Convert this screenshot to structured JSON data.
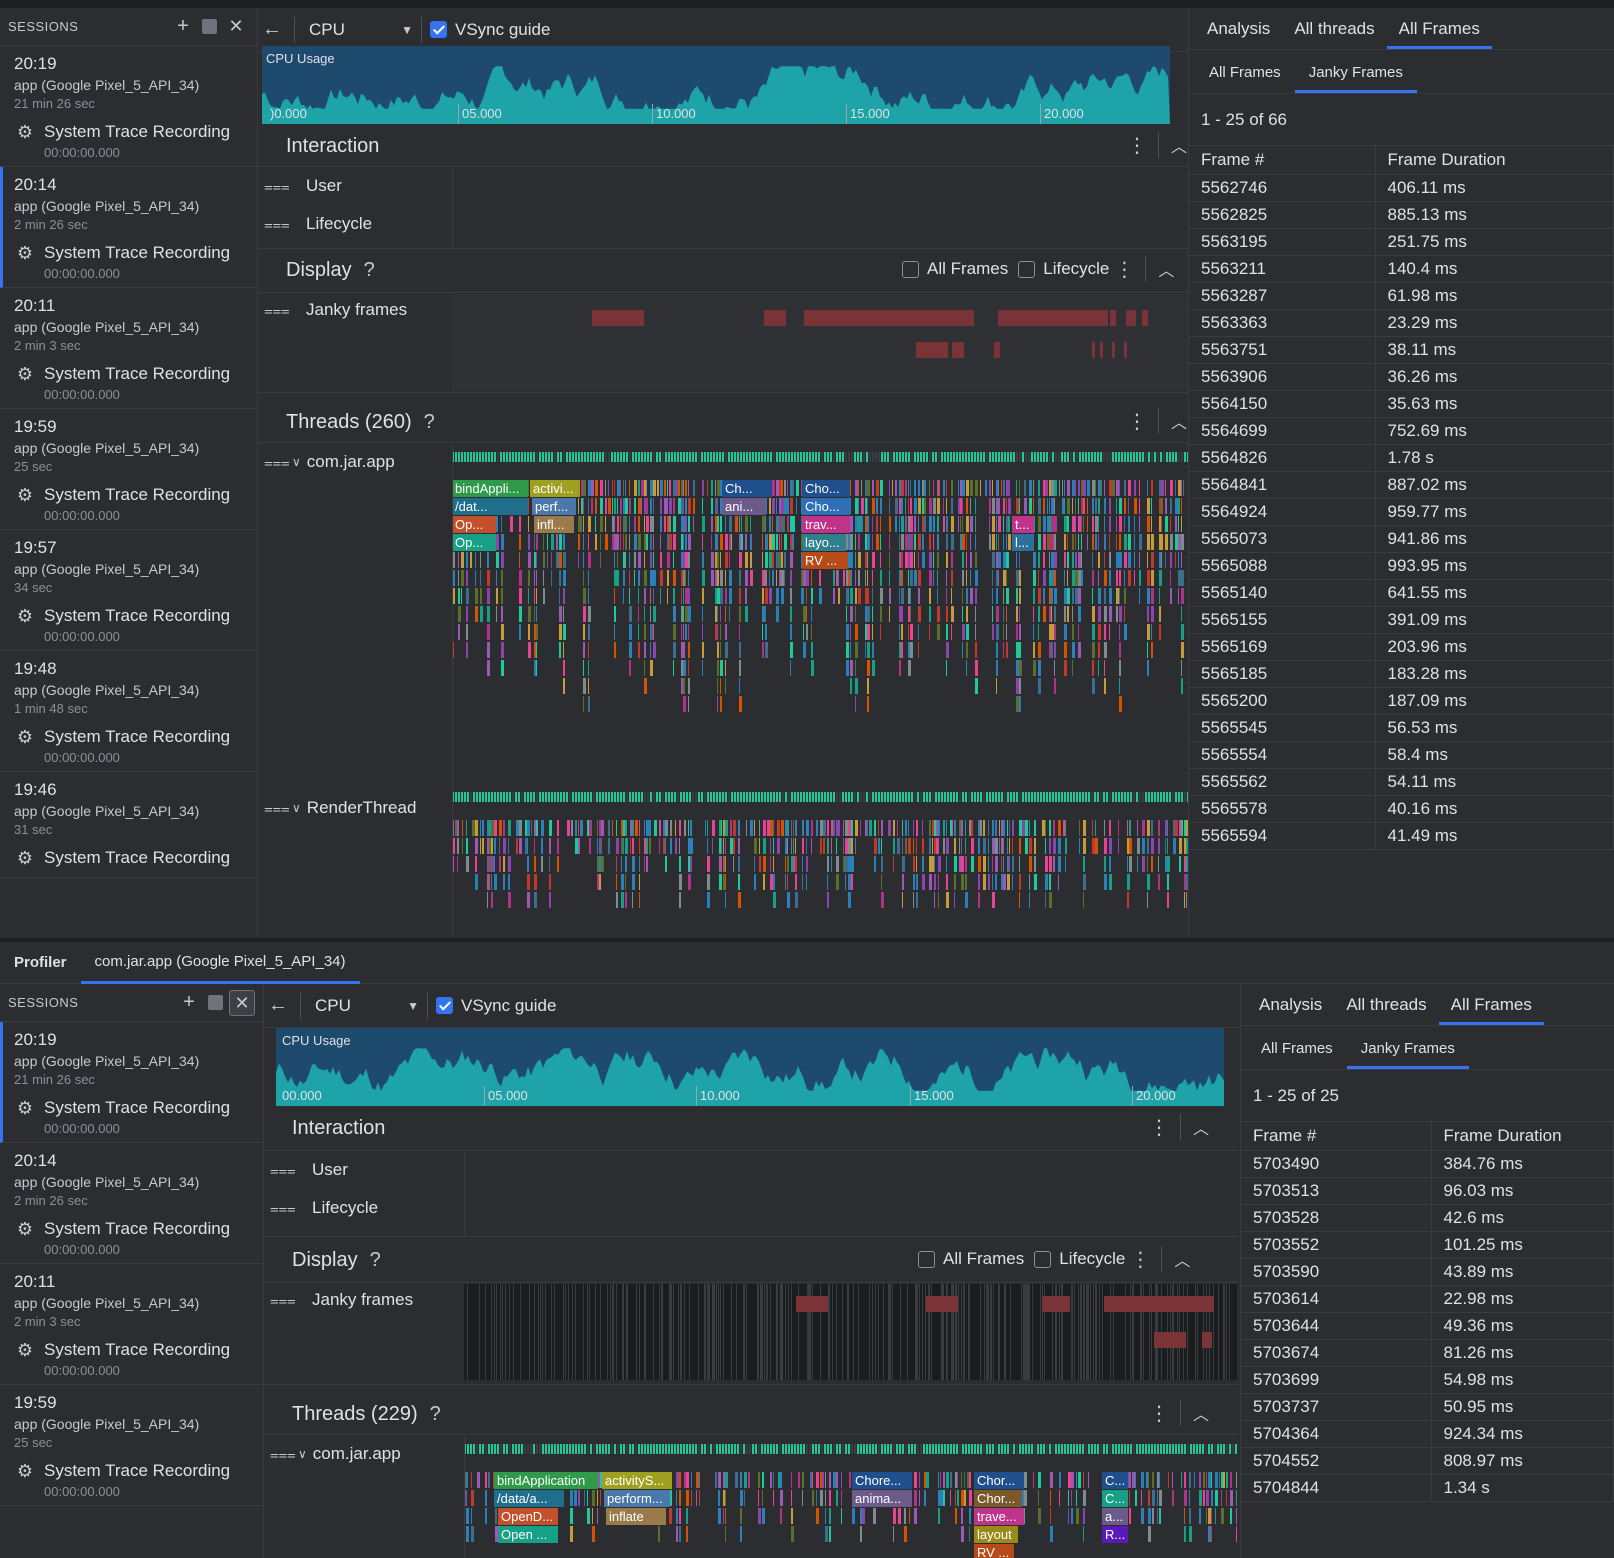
{
  "top": {
    "sessions_label": "SESSIONS",
    "sessions": [
      {
        "time": "20:19",
        "app": "app (Google Pixel_5_API_34)",
        "duration": "21 min 26 sec",
        "recording": "System Trace Recording",
        "rec_duration": "00:00:00.000"
      },
      {
        "time": "20:14",
        "app": "app (Google Pixel_5_API_34)",
        "duration": "2 min 26 sec",
        "recording": "System Trace Recording",
        "rec_duration": "00:00:00.000"
      },
      {
        "time": "20:11",
        "app": "app (Google Pixel_5_API_34)",
        "duration": "2 min 3 sec",
        "recording": "System Trace Recording",
        "rec_duration": "00:00:00.000"
      },
      {
        "time": "19:59",
        "app": "app (Google Pixel_5_API_34)",
        "duration": "25 sec",
        "recording": "System Trace Recording",
        "rec_duration": "00:00:00.000"
      },
      {
        "time": "19:57",
        "app": "app (Google Pixel_5_API_34)",
        "duration": "34 sec",
        "recording": "System Trace Recording",
        "rec_duration": "00:00:00.000"
      },
      {
        "time": "19:48",
        "app": "app (Google Pixel_5_API_34)",
        "duration": "1 min 48 sec",
        "recording": "System Trace Recording",
        "rec_duration": "00:00:00.000"
      },
      {
        "time": "19:46",
        "app": "app (Google Pixel_5_API_34)",
        "duration": "31 sec",
        "recording": "System Trace Recording",
        "rec_duration": ""
      }
    ],
    "toolbar": {
      "profiler_select": "CPU",
      "vsync_label": "VSync guide",
      "vsync_checked": true
    },
    "cpu": {
      "title": "CPU Usage",
      "ticks": [
        "00.000",
        "05.000",
        "10.000",
        "15.000",
        "20.000"
      ],
      "title_clip": "CPU Usage",
      "first_tick_clip": ")0.000"
    },
    "interaction": {
      "title": "Interaction",
      "tracks": [
        "User",
        "Lifecycle"
      ]
    },
    "display": {
      "title": "Display",
      "help": "?",
      "all_frames_label": "All Frames",
      "lifecycle_label": "Lifecycle",
      "track": "Janky frames"
    },
    "threads": {
      "title": "Threads (260)",
      "help": "?",
      "app_thread": "com.jar.app",
      "render_thread": "RenderThread",
      "slices": [
        "bindAppli...",
        "activi...",
        "/dat...",
        "perf...",
        "Op...",
        "infl...",
        "Op...",
        "Ch...",
        "ani...",
        "Cho...",
        "Cho...",
        "trav...",
        "layo...",
        "RV ...",
        "t...",
        "l..."
      ]
    },
    "right": {
      "tabs": [
        "Analysis",
        "All threads",
        "All Frames"
      ],
      "selected_tab": "All Frames",
      "subtabs": [
        "All Frames",
        "Janky Frames"
      ],
      "selected_subtab": "Janky Frames",
      "pager": "1 - 25 of 66",
      "col_frame": "Frame #",
      "col_duration": "Frame Duration",
      "rows": [
        [
          "5562746",
          "406.11 ms"
        ],
        [
          "5562825",
          "885.13 ms"
        ],
        [
          "5563195",
          "251.75 ms"
        ],
        [
          "5563211",
          "140.4 ms"
        ],
        [
          "5563287",
          "61.98 ms"
        ],
        [
          "5563363",
          "23.29 ms"
        ],
        [
          "5563751",
          "38.11 ms"
        ],
        [
          "5563906",
          "36.26 ms"
        ],
        [
          "5564150",
          "35.63 ms"
        ],
        [
          "5564699",
          "752.69 ms"
        ],
        [
          "5564826",
          "1.78 s"
        ],
        [
          "5564841",
          "887.02 ms"
        ],
        [
          "5564924",
          "959.77 ms"
        ],
        [
          "5565073",
          "941.86 ms"
        ],
        [
          "5565088",
          "993.95 ms"
        ],
        [
          "5565140",
          "641.55 ms"
        ],
        [
          "5565155",
          "391.09 ms"
        ],
        [
          "5565169",
          "203.96 ms"
        ],
        [
          "5565185",
          "183.28 ms"
        ],
        [
          "5565200",
          "187.09 ms"
        ],
        [
          "5565545",
          "56.53 ms"
        ],
        [
          "5565554",
          "58.4 ms"
        ],
        [
          "5565562",
          "54.11 ms"
        ],
        [
          "5565578",
          "40.16 ms"
        ],
        [
          "5565594",
          "41.49 ms"
        ]
      ]
    }
  },
  "bottom": {
    "tabstrip": {
      "profiler": "Profiler",
      "tab": "com.jar.app (Google Pixel_5_API_34)"
    },
    "sessions_label": "SESSIONS",
    "sessions": [
      {
        "time": "20:19",
        "app": "app (Google Pixel_5_API_34)",
        "duration": "21 min 26 sec",
        "recording": "System Trace Recording",
        "rec_duration": "00:00:00.000"
      },
      {
        "time": "20:14",
        "app": "app (Google Pixel_5_API_34)",
        "duration": "2 min 26 sec",
        "recording": "System Trace Recording",
        "rec_duration": "00:00:00.000"
      },
      {
        "time": "20:11",
        "app": "app (Google Pixel_5_API_34)",
        "duration": "2 min 3 sec",
        "recording": "System Trace Recording",
        "rec_duration": "00:00:00.000"
      },
      {
        "time": "19:59",
        "app": "app (Google Pixel_5_API_34)",
        "duration": "25 sec",
        "recording": "System Trace Recording",
        "rec_duration": "00:00:00.000"
      }
    ],
    "toolbar": {
      "profiler_select": "CPU",
      "vsync_label": "VSync guide",
      "vsync_checked": true
    },
    "cpu": {
      "title": "CPU Usage",
      "ticks": [
        "00.000",
        "05.000",
        "10.000",
        "15.000",
        "20.000"
      ]
    },
    "interaction": {
      "title": "Interaction",
      "tracks": [
        "User",
        "Lifecycle"
      ]
    },
    "display": {
      "title": "Display",
      "help": "?",
      "all_frames_label": "All Frames",
      "lifecycle_label": "Lifecycle",
      "track": "Janky frames"
    },
    "threads": {
      "title": "Threads (229)",
      "help": "?",
      "app_thread": "com.jar.app",
      "slices": [
        "bindApplication",
        "activityS...",
        "/data/a...",
        "perform...",
        "OpenD...",
        "inflate",
        "Open ...",
        "Chore...",
        "anima...",
        "Chor...",
        "Chor...",
        "trave...",
        "layout",
        "RV ...",
        "C...",
        "C...",
        "a...",
        "R..."
      ]
    },
    "right": {
      "tabs": [
        "Analysis",
        "All threads",
        "All Frames"
      ],
      "selected_tab": "All Frames",
      "subtabs": [
        "All Frames",
        "Janky Frames"
      ],
      "selected_subtab": "Janky Frames",
      "pager": "1 - 25 of 25",
      "col_frame": "Frame #",
      "col_duration": "Frame Duration",
      "rows": [
        [
          "5703490",
          "384.76 ms"
        ],
        [
          "5703513",
          "96.03 ms"
        ],
        [
          "5703528",
          "42.6 ms"
        ],
        [
          "5703552",
          "101.25 ms"
        ],
        [
          "5703590",
          "43.89 ms"
        ],
        [
          "5703614",
          "22.98 ms"
        ],
        [
          "5703644",
          "49.36 ms"
        ],
        [
          "5703674",
          "81.26 ms"
        ],
        [
          "5703699",
          "54.98 ms"
        ],
        [
          "5703737",
          "50.95 ms"
        ],
        [
          "5704364",
          "924.34 ms"
        ],
        [
          "5704552",
          "808.97 ms"
        ],
        [
          "5704844",
          "1.34 s"
        ]
      ]
    }
  },
  "colors": {
    "accent": "#3574f0",
    "cpu_area": "#1ea3a8",
    "cpu_bg": "#1e4a6e",
    "janky": "#7a3438",
    "thread_green": "#1fc99a"
  },
  "icons": {
    "add": "plus-icon",
    "stop": "stop-icon",
    "close": "close-icon",
    "back": "back-arrow-icon",
    "chip": "cpu-chip-icon",
    "filter": "track-filter-icon",
    "kebab": "more-vert-icon",
    "collapse": "chevron-up-icon",
    "expand": "chevron-down-icon",
    "dropdown": "caret-down-icon"
  }
}
